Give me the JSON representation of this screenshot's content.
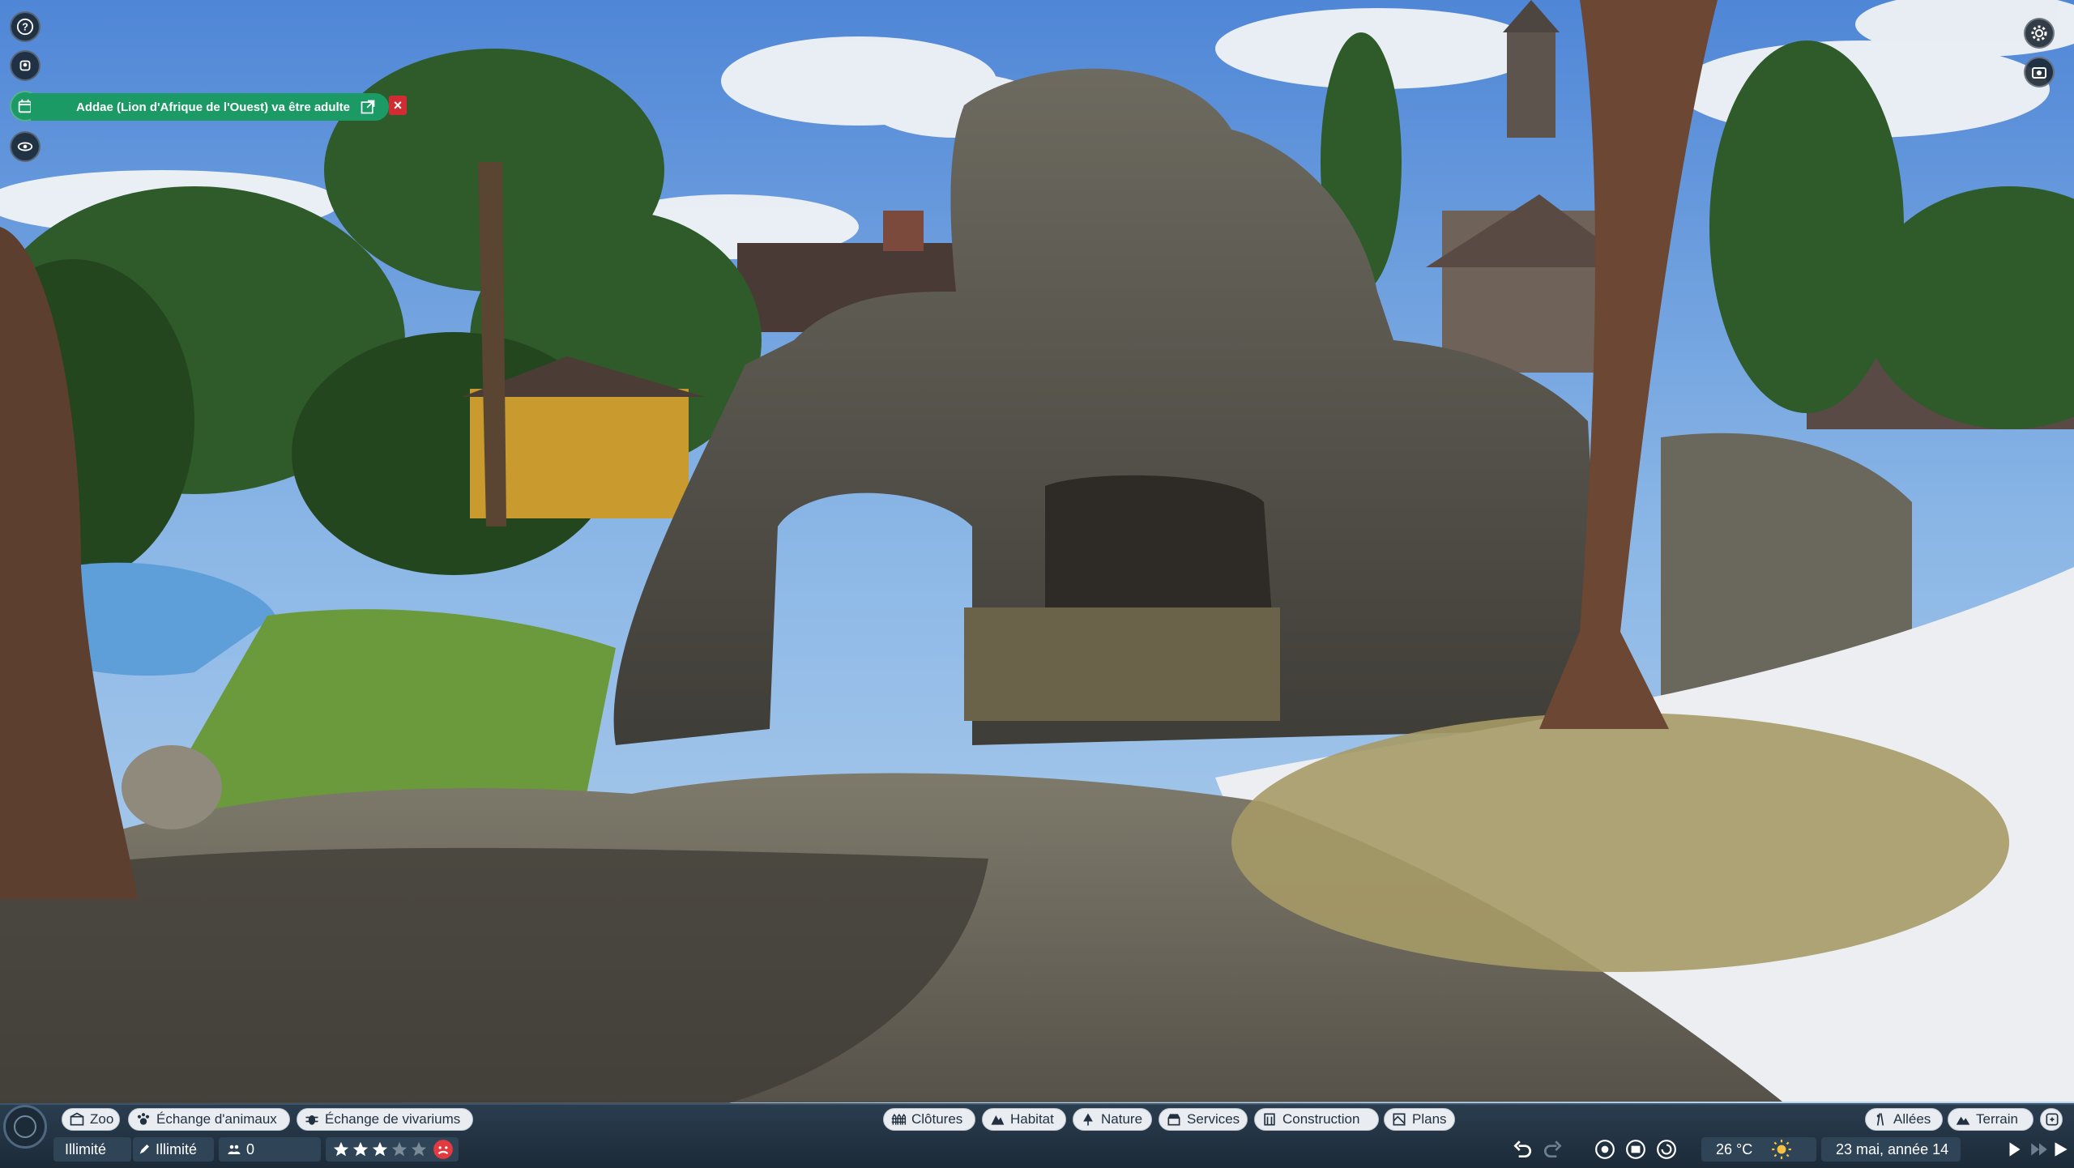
{
  "notification": {
    "text": "Addae (Lion d'Afrique de l'Ouest) va être adulte",
    "icon": "external-link-icon",
    "close_label": "×",
    "color": "#1c9a66"
  },
  "left_icons": [
    "help-icon",
    "zookeeper-icon",
    "calendar-icon",
    "visibility-icon"
  ],
  "right_icons": [
    "settings-gear-icon",
    "camera-mode-icon"
  ],
  "toolbar_left": [
    {
      "label": "Zoo",
      "icon": "zoo-icon"
    },
    {
      "label": "Échange d'animaux",
      "icon": "paw-icon"
    },
    {
      "label": "Échange de vivariums",
      "icon": "bug-icon"
    }
  ],
  "toolbar_center": [
    {
      "label": "Clôtures",
      "icon": "fence-icon"
    },
    {
      "label": "Habitat",
      "icon": "habitat-icon"
    },
    {
      "label": "Nature",
      "icon": "tree-icon"
    },
    {
      "label": "Services",
      "icon": "shop-icon"
    },
    {
      "label": "Construction",
      "icon": "building-icon"
    },
    {
      "label": "Plans",
      "icon": "blueprint-icon"
    }
  ],
  "toolbar_right": [
    {
      "label": "Allées",
      "icon": "path-icon"
    },
    {
      "label": "Terrain",
      "icon": "terrain-icon"
    }
  ],
  "status": {
    "money": "Illimité",
    "research": "Illimité",
    "guests": "0",
    "rating_stars": 3,
    "rating_max": 5,
    "temperature": "26 °C",
    "weather_icon": "sun-icon",
    "date": "23 mai, année 14"
  },
  "colors": {
    "bar_bg": "#1c2a38",
    "pill_bg": "#e9edf1",
    "accent_green": "#1c9a66",
    "close_red": "#d02c34",
    "star_empty": "#7a8a97",
    "star_filled": "#ffffff"
  }
}
